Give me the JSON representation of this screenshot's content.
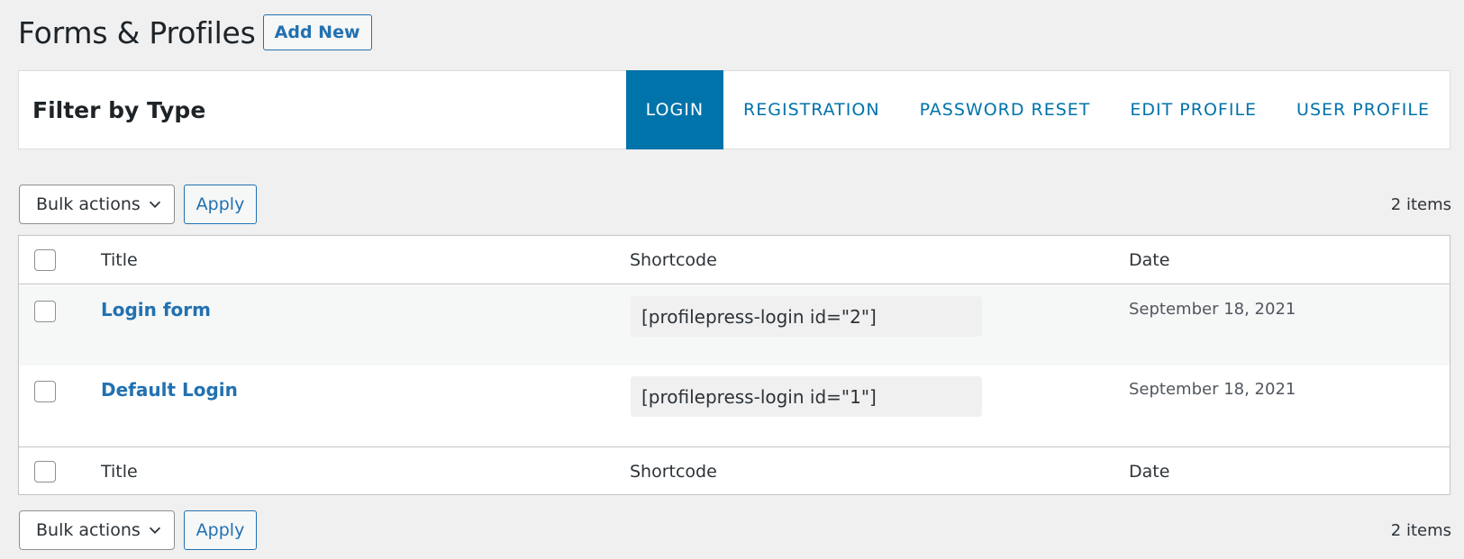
{
  "header": {
    "title": "Forms & Profiles",
    "add_new_label": "Add New"
  },
  "filter": {
    "label": "Filter by Type",
    "tabs": [
      {
        "label": "LOGIN",
        "active": true
      },
      {
        "label": "REGISTRATION",
        "active": false
      },
      {
        "label": "PASSWORD RESET",
        "active": false
      },
      {
        "label": "EDIT PROFILE",
        "active": false
      },
      {
        "label": "USER PROFILE",
        "active": false
      }
    ]
  },
  "tablenav": {
    "bulk_actions_label": "Bulk actions",
    "apply_label": "Apply",
    "items_count": "2 items"
  },
  "table": {
    "columns": [
      "Title",
      "Shortcode",
      "Date"
    ],
    "rows": [
      {
        "title": "Login form",
        "shortcode": "[profilepress-login id=\"2\"]",
        "date": "September 18, 2021"
      },
      {
        "title": "Default Login",
        "shortcode": "[profilepress-login id=\"1\"]",
        "date": "September 18, 2021"
      }
    ]
  },
  "colors": {
    "accent": "#0073aa",
    "link": "#2271b1",
    "background": "#f0f0f1"
  }
}
